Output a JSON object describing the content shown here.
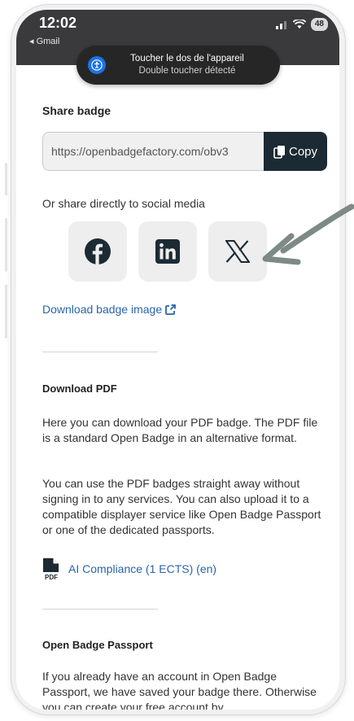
{
  "status_bar": {
    "time": "12:02",
    "back_app": "◂ Gmail",
    "battery": "48"
  },
  "toast": {
    "line1": "Toucher le dos de l'appareil",
    "line2": "Double toucher détecté"
  },
  "share": {
    "heading": "Share badge",
    "url_value": "https://openbadgefactory.com/obv3",
    "copy_label": "Copy",
    "social_label": "Or share directly to social media",
    "social_buttons": [
      {
        "icon": "facebook-icon"
      },
      {
        "icon": "linkedin-icon"
      },
      {
        "icon": "x-icon"
      }
    ],
    "download_image_label": "Download badge image"
  },
  "pdf": {
    "heading": "Download PDF",
    "para1": "Here you can download your PDF badge. The PDF file is a standard Open Badge in an alternative format.",
    "para2": "You can use the PDF badges straight away without signing in to any services. You can also upload it to a compatible displayer service like Open Badge Passport or one of the dedicated passports.",
    "file_icon_label": "PDF",
    "file_link": "AI Compliance (1 ECTS) (en)"
  },
  "passport": {
    "heading": "Open Badge Passport",
    "para": "If you already have an account in Open Badge Passport, we have saved your badge there. Otherwise you can create your free account by"
  },
  "colors": {
    "link": "#2a64ab",
    "copy_button": "#1c2a33",
    "annotation_arrow": "#7d8a86"
  }
}
